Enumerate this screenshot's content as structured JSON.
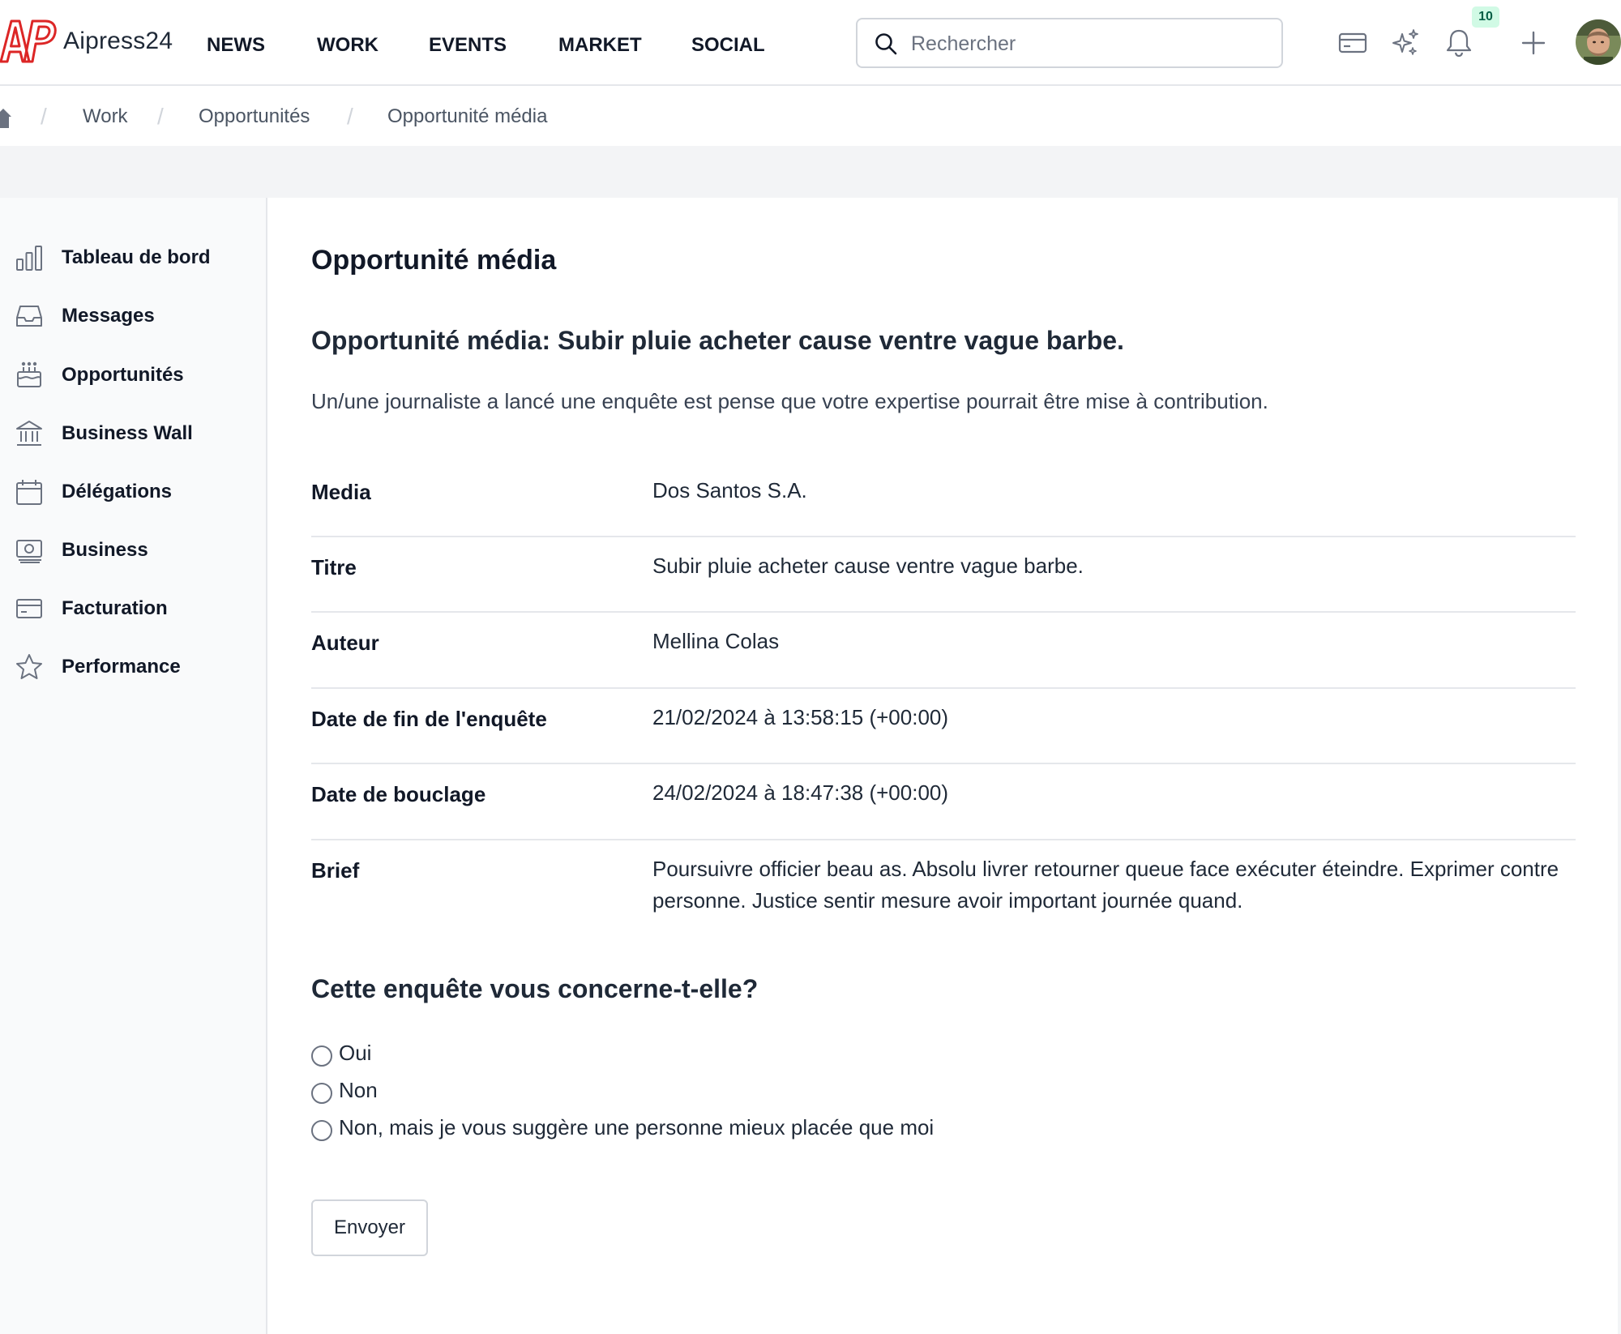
{
  "header": {
    "brand": "Aipress24",
    "nav": [
      "NEWS",
      "WORK",
      "EVENTS",
      "MARKET",
      "SOCIAL"
    ],
    "search_placeholder": "Rechercher",
    "notification_count": "10",
    "icons": [
      "credit-card-icon",
      "sparkles-icon",
      "bell-icon",
      "plus-icon"
    ]
  },
  "breadcrumb": {
    "items": [
      "Work",
      "Opportunités",
      "Opportunité média"
    ]
  },
  "sidebar": {
    "items": [
      {
        "label": "Tableau de bord",
        "icon": "bar-chart-icon"
      },
      {
        "label": "Messages",
        "icon": "inbox-icon"
      },
      {
        "label": "Opportunités",
        "icon": "cake-icon"
      },
      {
        "label": "Business Wall",
        "icon": "building-columns-icon"
      },
      {
        "label": "Délégations",
        "icon": "calendar-icon"
      },
      {
        "label": "Business",
        "icon": "banknotes-icon"
      },
      {
        "label": "Facturation",
        "icon": "credit-card-icon"
      },
      {
        "label": "Performance",
        "icon": "star-icon"
      }
    ]
  },
  "main": {
    "page_title": "Opportunité média",
    "heading": "Opportunité média: Subir pluie acheter cause ventre vague barbe.",
    "intro": "Un/une journaliste a lancé une enquête est pense que votre expertise pourrait être mise à contribution.",
    "details": [
      {
        "label": "Media",
        "value": "Dos Santos S.A."
      },
      {
        "label": "Titre",
        "value": "Subir pluie acheter cause ventre vague barbe."
      },
      {
        "label": "Auteur",
        "value": "Mellina Colas"
      },
      {
        "label": "Date de fin de l'enquête",
        "value": "21/02/2024 à 13:58:15 (+00:00)"
      },
      {
        "label": "Date de bouclage",
        "value": "24/02/2024 à 18:47:38 (+00:00)"
      },
      {
        "label": "Brief",
        "value": "Poursuivre officier beau as. Absolu livrer retourner queue face exécuter éteindre. Exprimer contre personne. Justice sentir mesure avoir important journée quand."
      }
    ],
    "question": "Cette enquête vous concerne-t-elle?",
    "options": [
      "Oui",
      "Non",
      "Non, mais je vous suggère une personne mieux placée que moi"
    ],
    "submit_label": "Envoyer"
  },
  "colors": {
    "brand_red": "#dc2626",
    "badge_bg": "#d1fae5",
    "badge_text": "#065f46",
    "sidebar_bg": "#f9fafb",
    "border": "#e5e7eb"
  }
}
